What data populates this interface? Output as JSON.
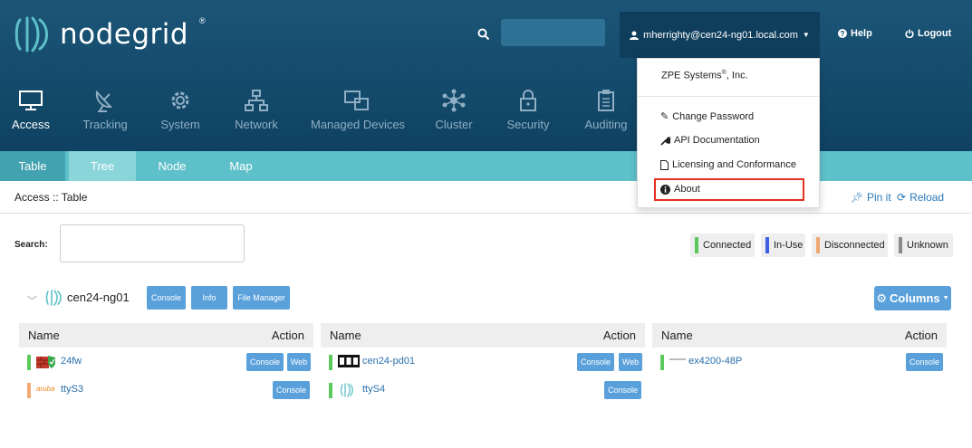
{
  "header": {
    "logo_text": "nodegrid",
    "logo_mark": "®",
    "user_menu_label": "mherrighty@cen24-ng01.local.com",
    "help_label": "Help",
    "logout_label": "Logout",
    "search_icon": "search-icon"
  },
  "nav": [
    {
      "label": "Access",
      "icon": "monitor-icon",
      "active": true
    },
    {
      "label": "Tracking",
      "icon": "satellite-dish-icon",
      "active": false
    },
    {
      "label": "System",
      "icon": "gear-icon",
      "active": false
    },
    {
      "label": "Network",
      "icon": "network-icon",
      "active": false
    },
    {
      "label": "Managed Devices",
      "icon": "devices-icon",
      "active": false
    },
    {
      "label": "Cluster",
      "icon": "cluster-icon",
      "active": false
    },
    {
      "label": "Security",
      "icon": "lock-icon",
      "active": false
    },
    {
      "label": "Auditing",
      "icon": "clipboard-icon",
      "active": false
    }
  ],
  "subtabs": [
    "Table",
    "Tree",
    "Node",
    "Map"
  ],
  "breadcrumb": "Access :: Table",
  "actions": {
    "pin": "Pin it",
    "reload": "Reload"
  },
  "search": {
    "label": "Search:",
    "placeholder": ""
  },
  "legend": [
    {
      "label": "Connected",
      "color": "#5dc95d"
    },
    {
      "label": "In-Use",
      "color": "#3f5fe0"
    },
    {
      "label": "Disconnected",
      "color": "#f0a874"
    },
    {
      "label": "Unknown",
      "color": "#8a8a8a"
    }
  ],
  "device": {
    "name": "cen24-ng01",
    "buttons": [
      "Console",
      "Info",
      "File Manager"
    ],
    "columns_label": "Columns"
  },
  "tables": [
    {
      "header_name": "Name",
      "header_action": "Action",
      "rows": [
        {
          "name": "24fw",
          "status_color": "#5dc95d",
          "icon": "firewall-icon",
          "actions": [
            "Console",
            "Web"
          ]
        },
        {
          "name": "ttyS3",
          "status_color": "#f0a874",
          "icon": "aruba-logo",
          "icon_text": "aruba",
          "actions": [
            "Console"
          ]
        }
      ]
    },
    {
      "header_name": "Name",
      "header_action": "Action",
      "rows": [
        {
          "name": "cen24-pd01",
          "status_color": "#5dc95d",
          "icon": "pdu-icon",
          "actions": [
            "Console",
            "Web"
          ]
        },
        {
          "name": "ttyS4",
          "status_color": "#5dc95d",
          "icon": "nodegrid-icon",
          "actions": [
            "Console"
          ]
        }
      ]
    },
    {
      "header_name": "Name",
      "header_action": "Action",
      "rows": [
        {
          "name": "ex4200-48P",
          "status_color": "#5dc95d",
          "icon": "juniper-logo",
          "actions": [
            "Console"
          ]
        }
      ]
    }
  ],
  "dropdown": {
    "company": "ZPE Systems",
    "company_mark": "®",
    "company_suffix": ", Inc.",
    "items": [
      {
        "label": "Change Password",
        "icon": "pencil-icon"
      },
      {
        "label": "API Documentation",
        "icon": "wrench-icon"
      },
      {
        "label": "Licensing and Conformance",
        "icon": "file-icon"
      },
      {
        "label": "About",
        "icon": "info-icon"
      }
    ]
  }
}
